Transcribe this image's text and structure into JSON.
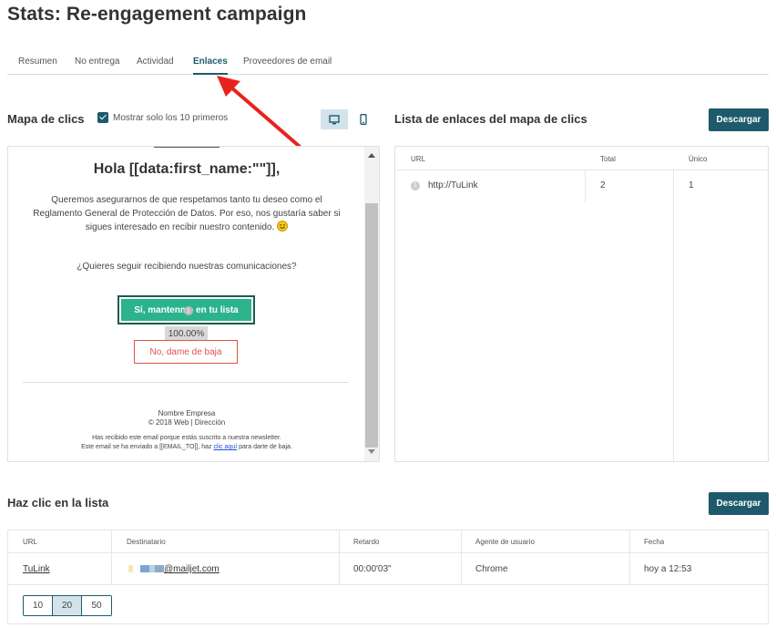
{
  "page": {
    "title": "Stats: Re-engagement campaign"
  },
  "tabs": [
    {
      "label": "Resumen"
    },
    {
      "label": "No entrega"
    },
    {
      "label": "Actividad"
    },
    {
      "label": "Enlaces",
      "active": true
    },
    {
      "label": "Proveedores de email"
    }
  ],
  "click_map": {
    "title": "Mapa de clics",
    "show_top10_label": "Mostrar solo los 10 primeros",
    "show_top10_checked": true,
    "view_modes": [
      {
        "name": "desktop",
        "icon": "desktop-icon",
        "active": true
      },
      {
        "name": "mobile",
        "icon": "mobile-icon",
        "active": false
      }
    ],
    "email": {
      "heading": "Hola [[data:first_name:\"\"]],",
      "paragraph": "Queremos asegurarnos de que respetamos tanto tu deseo como el Reglamento General de Protección de Datos. Por eso, nos gustaría saber si sigues interesado en recibir nuestro contenido.",
      "emoji_icon": "smile-icon",
      "question": "¿Quieres seguir recibiendo nuestras comunicaciones?",
      "keep_button": "Sí, mantenme en tu lista",
      "click_badge": "1",
      "click_percentage": "100.00%",
      "unsubscribe_button": "No, dame de baja",
      "footer_company": "Nombre Empresa",
      "footer_copyright": "© 2018 Web | Dirección",
      "footer_note_line1": "Has recibido este email porque estás suscrito a nuestra newsletter.",
      "footer_note_line2_prefix": "Este email se ha enviado a [[EMAIL_TO]], haz ",
      "footer_note_link": "clic aquí",
      "footer_note_line2_suffix": " para darte de baja."
    }
  },
  "link_list": {
    "title": "Lista de enlaces del mapa de clics",
    "download_label": "Descargar",
    "columns": {
      "url": "URL",
      "total": "Total",
      "unique": "Único"
    },
    "rows": [
      {
        "index": "1",
        "url": "http://TuLink",
        "total": "2",
        "unique": "1"
      }
    ]
  },
  "click_list": {
    "title": "Haz clic en la lista",
    "download_label": "Descargar",
    "columns": {
      "url": "URL",
      "recipient": "Destinatario",
      "delay": "Retardo",
      "user_agent": "Agente de usuario",
      "date": "Fecha"
    },
    "rows": [
      {
        "url": "TuLink",
        "recipient": "@mailjet.com",
        "delay": "00:00'03\"",
        "user_agent": "Chrome",
        "date": "hoy a 12:53"
      }
    ],
    "page_sizes": [
      {
        "label": "10",
        "active": false
      },
      {
        "label": "20",
        "active": true
      },
      {
        "label": "50",
        "active": false
      }
    ]
  },
  "colors": {
    "accent": "#1e5a6b",
    "keep_button": "#2bb38c",
    "unsubscribe": "#e0534a",
    "arrow": "#e8231f"
  }
}
